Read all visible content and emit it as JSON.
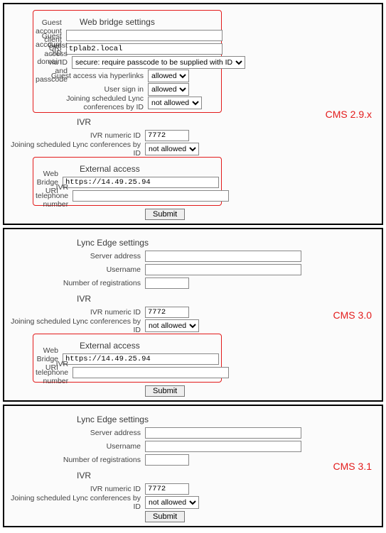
{
  "versions": {
    "v1": "CMS 2.9.x",
    "v2": "CMS 3.0",
    "v3": "CMS 3.1"
  },
  "sections": {
    "web_bridge": "Web bridge settings",
    "ivr": "IVR",
    "external": "External access",
    "lync_edge": "Lync Edge settings"
  },
  "labels": {
    "guest_client_uri": "Guest account client URI",
    "guest_jid_domain": "Guest account JID domain",
    "guest_id_pass": "Guest access via ID and passcode",
    "guest_hyper": "Guest access via hyperlinks",
    "user_signin": "User sign in",
    "join_lync": "Joining scheduled Lync conferences by ID",
    "ivr_numeric": "IVR numeric ID",
    "web_bridge_uri": "Web Bridge URI",
    "ivr_tel": "IVR telephone number",
    "server_addr": "Server address",
    "username": "Username",
    "num_reg": "Number of registrations",
    "submit": "Submit"
  },
  "values": {
    "guest_client_uri": "",
    "guest_jid_domain": "tplab2.local",
    "guest_id_pass": "secure: require passcode to be supplied with ID",
    "allowed": "allowed",
    "not_allowed": "not allowed",
    "ivr_numeric": "7772",
    "web_bridge_uri": "https://14.49.25.94",
    "ivr_tel": "",
    "server_addr": "",
    "username": "",
    "num_reg": ""
  }
}
